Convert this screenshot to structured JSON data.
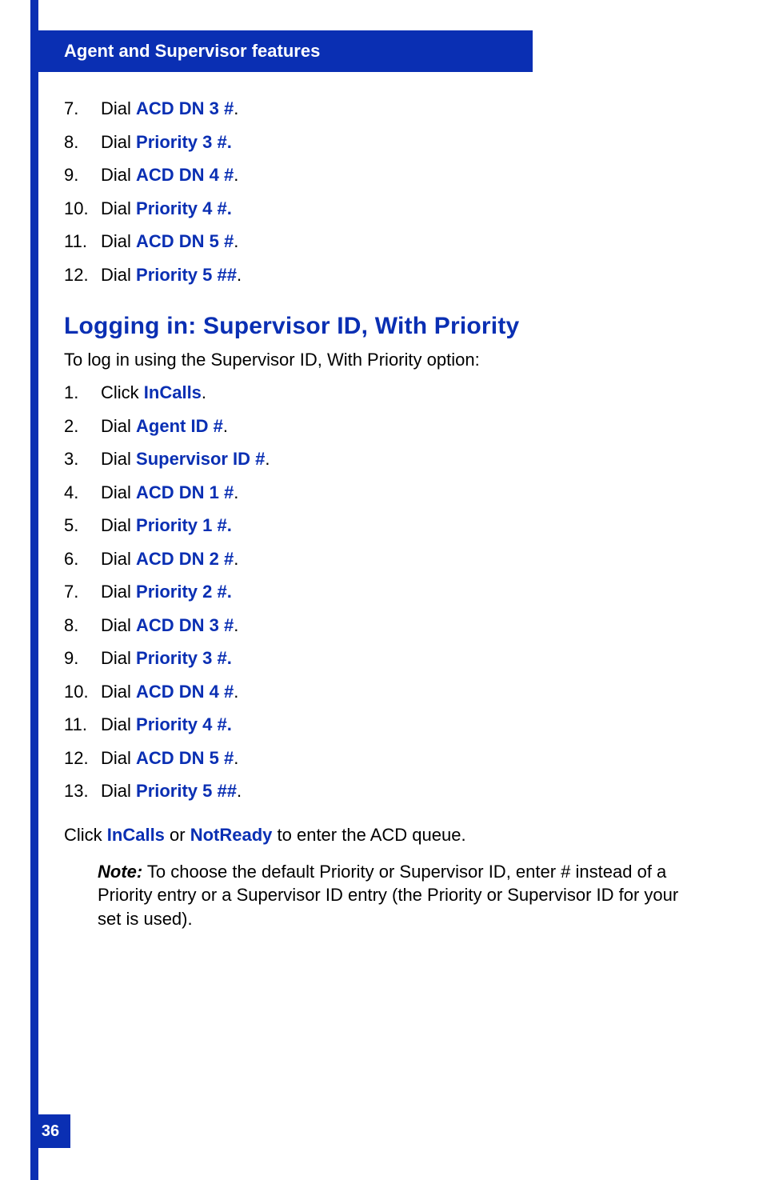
{
  "header": {
    "title": "Agent and Supervisor features"
  },
  "top_list": [
    {
      "n": "7.",
      "lead": "Dial ",
      "bold": "ACD DN 3 #",
      "tail": "."
    },
    {
      "n": "8.",
      "lead": "Dial ",
      "bold": "Priority 3 #.",
      "tail": ""
    },
    {
      "n": "9.",
      "lead": "Dial ",
      "bold": "ACD DN 4 #",
      "tail": "."
    },
    {
      "n": "10.",
      "lead": "Dial ",
      "bold": "Priority 4 #.",
      "tail": ""
    },
    {
      "n": "11.",
      "lead": "Dial ",
      "bold": "ACD DN 5 #",
      "tail": "."
    },
    {
      "n": "12.",
      "lead": "Dial ",
      "bold": "Priority 5 ##",
      "tail": "."
    }
  ],
  "section": {
    "heading": "Logging in: Supervisor ID, With Priority",
    "intro": "To log in using the Supervisor ID, With Priority option:",
    "list": [
      {
        "n": "1.",
        "lead": "Click ",
        "bold": "InCalls",
        "tail": "."
      },
      {
        "n": "2.",
        "lead": "Dial ",
        "bold": "Agent ID #",
        "tail": "."
      },
      {
        "n": "3.",
        "lead": "Dial ",
        "bold": "Supervisor ID #",
        "tail": "."
      },
      {
        "n": "4.",
        "lead": "Dial ",
        "bold": "ACD DN 1 #",
        "tail": "."
      },
      {
        "n": "5.",
        "lead": "Dial ",
        "bold": "Priority 1 #.",
        "tail": ""
      },
      {
        "n": "6.",
        "lead": "Dial ",
        "bold": "ACD DN 2 #",
        "tail": "."
      },
      {
        "n": "7.",
        "lead": "Dial ",
        "bold": "Priority 2 #.",
        "tail": ""
      },
      {
        "n": "8.",
        "lead": "Dial ",
        "bold": "ACD DN 3 #",
        "tail": "."
      },
      {
        "n": "9.",
        "lead": "Dial ",
        "bold": "Priority 3 #.",
        "tail": ""
      },
      {
        "n": "10.",
        "lead": "Dial ",
        "bold": "ACD DN 4 #",
        "tail": "."
      },
      {
        "n": "11.",
        "lead": "Dial ",
        "bold": "Priority 4 #.",
        "tail": ""
      },
      {
        "n": "12.",
        "lead": "Dial ",
        "bold": "ACD DN 5 #",
        "tail": "."
      },
      {
        "n": "13.",
        "lead": "Dial ",
        "bold": "Priority 5 ##",
        "tail": "."
      }
    ]
  },
  "click_line": {
    "pre": "Click ",
    "b1": "InCalls",
    "mid": " or ",
    "b2": "NotReady",
    "post": " to enter the ACD queue."
  },
  "note": {
    "label": "Note:",
    "text": " To choose the default Priority or Supervisor ID, enter # instead of a Priority entry or a Supervisor ID entry (the Priority or Supervisor ID for your set is used)."
  },
  "page_number": "36"
}
